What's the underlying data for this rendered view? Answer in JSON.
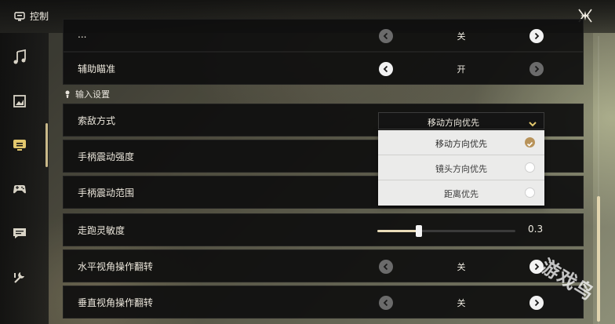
{
  "header": {
    "title": "控制",
    "title_icon": "controls-icon",
    "close_icon": "close-x-icon"
  },
  "sidebar": {
    "items": [
      {
        "icon": "music-note-icon",
        "active": false
      },
      {
        "icon": "display-icon",
        "active": false
      },
      {
        "icon": "controls-icon",
        "active": true
      },
      {
        "icon": "gamepad-icon",
        "active": false
      },
      {
        "icon": "chat-icon",
        "active": false
      },
      {
        "icon": "wrench-icon",
        "active": false
      }
    ]
  },
  "settings": {
    "partial_row": {
      "label": "...",
      "value": "关"
    },
    "aim_assist": {
      "label": "辅助瞄准",
      "value": "开"
    },
    "input_section": {
      "label": "输入设置",
      "icon": "person-icon"
    },
    "target_mode": {
      "label": "索敌方式",
      "selected": "移动方向优先",
      "options": [
        {
          "label": "移动方向优先",
          "selected": true
        },
        {
          "label": "镜头方向优先",
          "selected": false
        },
        {
          "label": "距离优先",
          "selected": false
        }
      ]
    },
    "vibration_strength": {
      "label": "手柄震动强度"
    },
    "vibration_range": {
      "label": "手柄震动范围"
    },
    "sprint_sensitivity": {
      "label": "走跑灵敏度",
      "value": "0.3",
      "level": 0.3
    },
    "invert_horizontal": {
      "label": "水平视角操作翻转",
      "value": "关"
    },
    "invert_vertical": {
      "label": "垂直视角操作翻转",
      "value": "关"
    }
  },
  "scrollbar": {
    "position": 0.85
  },
  "watermark": {
    "text": "游戏鸟"
  },
  "colors": {
    "accent": "#b8935a",
    "slider_fill": "#e9dcb8",
    "row_bg": "#0e0e0e"
  }
}
